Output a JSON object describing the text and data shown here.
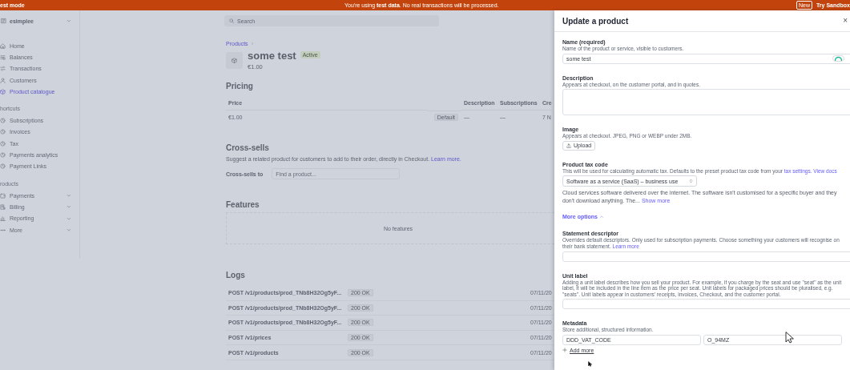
{
  "banner": {
    "mode": "est mode",
    "message": "You're using **test data**. No real transactions will be processed.",
    "badge": "New",
    "link": "Try Sandbox"
  },
  "account": {
    "name": "esimplee"
  },
  "search": {
    "placeholder": "Search"
  },
  "nav_groups": [
    {
      "items": [
        {
          "label": "Home",
          "selected": false,
          "expandable": false
        },
        {
          "label": "Balances",
          "selected": false,
          "expandable": false
        },
        {
          "label": "Transactions",
          "selected": false,
          "expandable": false
        },
        {
          "label": "Customers",
          "selected": false,
          "expandable": false
        },
        {
          "label": "Product catalogue",
          "selected": true,
          "expandable": false
        }
      ]
    },
    {
      "heading": "hortcuts",
      "items": [
        {
          "label": "Subscriptions",
          "selected": false,
          "expandable": false
        },
        {
          "label": "Invoices",
          "selected": false,
          "expandable": false
        },
        {
          "label": "Tax",
          "selected": false,
          "expandable": false
        },
        {
          "label": "Payments analytics",
          "selected": false,
          "expandable": false
        },
        {
          "label": "Payment Links",
          "selected": false,
          "expandable": false
        }
      ]
    },
    {
      "heading": "roducts",
      "items": [
        {
          "label": "Payments",
          "selected": false,
          "expandable": true
        },
        {
          "label": "Billing",
          "selected": false,
          "expandable": true
        },
        {
          "label": "Reporting",
          "selected": false,
          "expandable": true
        },
        {
          "label": "More",
          "selected": false,
          "expandable": true
        }
      ]
    }
  ],
  "product": {
    "breadcrumb": "Products",
    "name": "some test",
    "status": "Active",
    "price": "€1.00",
    "pricing": {
      "heading": "Pricing",
      "columns": [
        "Price",
        "Description",
        "Subscriptions",
        "Cre"
      ],
      "rows": [
        {
          "price": "€1.00",
          "badge": "Default",
          "description": "—",
          "subscriptions": "—",
          "created": "7 N"
        }
      ]
    },
    "cross_sells": {
      "heading": "Cross-sells",
      "text": "Suggest a related product for customers to add to their order, directly in Checkout.",
      "link": "Learn more.",
      "label": "Cross-sells to",
      "placeholder": "Find a product..."
    },
    "features": {
      "heading": "Features",
      "empty": "No features"
    },
    "logs": {
      "heading": "Logs",
      "rows": [
        {
          "request": "POST /v1/products/prod_TNb8H32Og5yF...",
          "status": "200 OK",
          "date": "07/11/20"
        },
        {
          "request": "POST /v1/products/prod_TNb8H32Og5yF...",
          "status": "200 OK",
          "date": "07/11/20"
        },
        {
          "request": "POST /v1/products/prod_TNb8H32Og5yF...",
          "status": "200 OK",
          "date": "07/11/20"
        },
        {
          "request": "POST /v1/prices",
          "status": "200 OK",
          "date": "07/11/20"
        },
        {
          "request": "POST /v1/products",
          "status": "200 OK",
          "date": "07/11/20"
        }
      ]
    }
  },
  "panel": {
    "title": "Update a product",
    "close": "×",
    "sections": [
      {
        "kind": "input",
        "label": "Name (required)",
        "hint": [
          {
            "kind": "text",
            "text": "Name of the product or service, visible to customers."
          }
        ],
        "value": "some test"
      },
      {
        "kind": "textarea",
        "label": "Description",
        "hint": [
          {
            "kind": "text",
            "text": "Appears at checkout, on the customer portal, and in quotes."
          }
        ]
      },
      {
        "kind": "upload",
        "label": "Image",
        "hint": [
          {
            "kind": "text",
            "text": "Appears at checkout. JPEG, PNG or WEBP under 2MB."
          }
        ],
        "button": "Upload"
      },
      {
        "kind": "select",
        "label": "Product tax code",
        "hint": [
          {
            "kind": "text",
            "text": "This will be used for calculating automatic tax. Defaults to the preset product tax code from your"
          },
          {
            "kind": "link",
            "text": "tax settings."
          },
          {
            "kind": "link",
            "text": "View docs"
          }
        ],
        "value": "Software as a service (SaaS) – business use",
        "note": "Cloud services software delivered over the internet. The software isn't customised for a specific buyer and they don't download anything. The...",
        "more": "Show more"
      },
      {
        "kind": "toggle",
        "label": "More options",
        "expanded": true
      },
      {
        "kind": "input",
        "label": "Statement descriptor",
        "hint": [
          {
            "kind": "text",
            "text": "Overrides default descriptors. Only used for subscription payments. Choose something your customers will recognise on their bank statement."
          },
          {
            "kind": "link",
            "text": "Learn more"
          }
        ]
      },
      {
        "kind": "input",
        "label": "Unit label",
        "hint": [
          {
            "kind": "text",
            "text": "Adding a unit label describes how you sell your product. For example, if you charge by the seat and use \"seat\" as the unit label, it will be included in the line item as the price per seat. Unit labels for packaged prices should be pluralised, e.g. \"seats\". Unit labels appear in customers' receipts, invoices, Checkout, and the customer portal."
          }
        ]
      },
      {
        "kind": "metadata",
        "label": "Metadata",
        "hint": [
          {
            "kind": "text",
            "text": "Store additional, structured information."
          }
        ],
        "key": "DDD_VAT_CODE",
        "value": "O_94MZ",
        "add": "Add more"
      }
    ]
  }
}
